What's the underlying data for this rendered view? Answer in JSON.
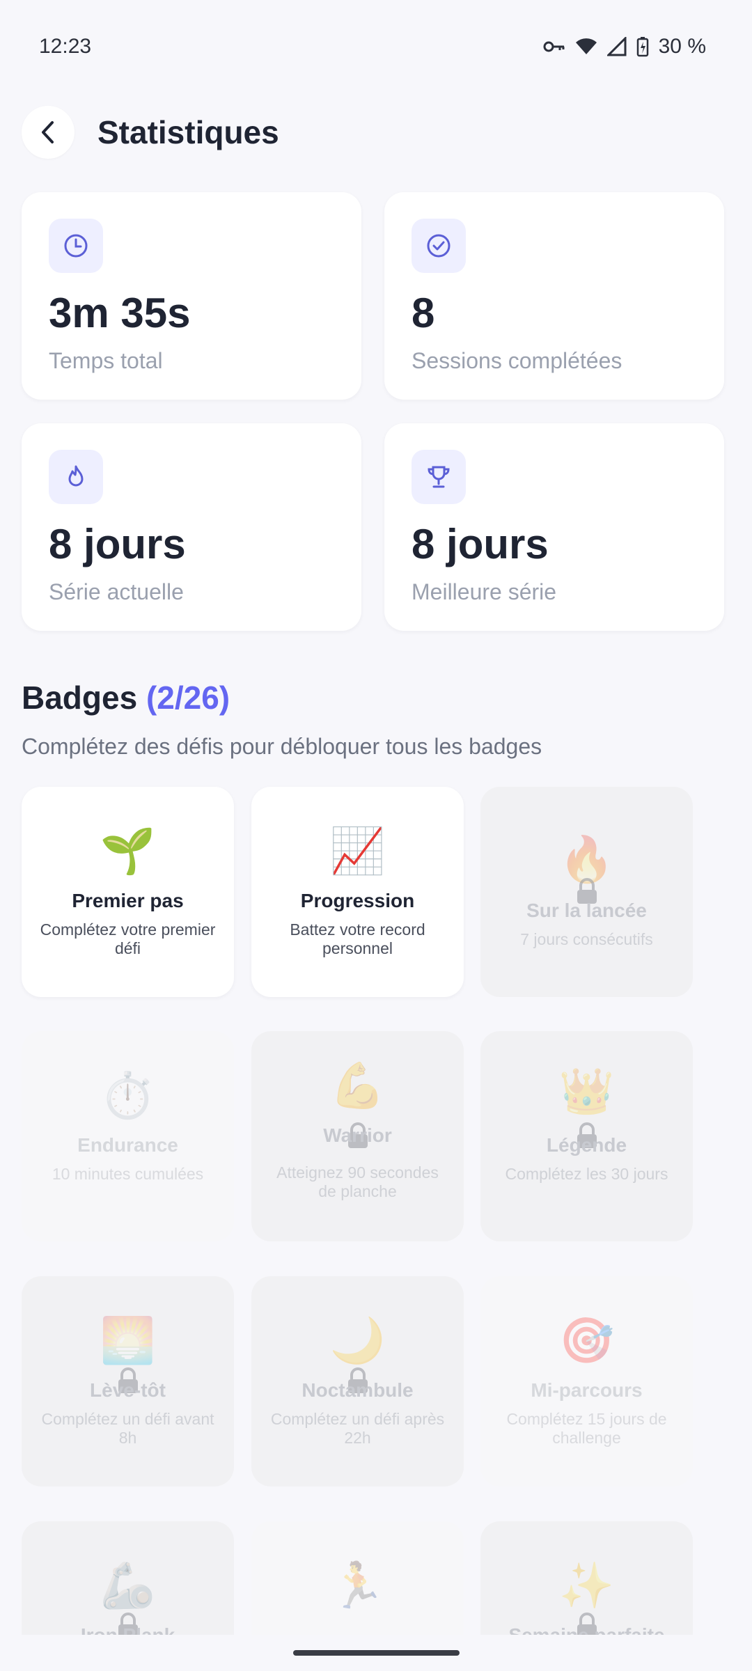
{
  "status_bar": {
    "time": "12:23",
    "battery": "30 %"
  },
  "header": {
    "title": "Statistiques"
  },
  "stats": [
    {
      "value": "3m 35s",
      "label": "Temps total",
      "icon": "clock-icon"
    },
    {
      "value": "8",
      "label": "Sessions complétées",
      "icon": "check-circle-icon"
    },
    {
      "value": "8 jours",
      "label": "Série actuelle",
      "icon": "flame-icon"
    },
    {
      "value": "8 jours",
      "label": "Meilleure série",
      "icon": "trophy-icon"
    }
  ],
  "badges": {
    "title": "Badges",
    "count": "(2/26)",
    "subtitle": "Complétez des défis pour débloquer tous les badges",
    "items": [
      {
        "emoji": "🌱",
        "name": "Premier pas",
        "desc": "Complétez votre premier défi",
        "locked": false
      },
      {
        "emoji": "📈",
        "name": "Progression",
        "desc": "Battez votre record personnel",
        "locked": false
      },
      {
        "emoji": "🔥",
        "name": "Sur la lancée",
        "desc": "7 jours consécutifs",
        "locked": true
      },
      {
        "emoji": "⏱️",
        "name": "Endurance",
        "desc": "10 minutes cumulées",
        "locked": true
      },
      {
        "emoji": "💪",
        "name": "Warrior",
        "desc": "Atteignez 90 secondes de planche",
        "locked": true
      },
      {
        "emoji": "👑",
        "name": "Légende",
        "desc": "Complétez les 30 jours",
        "locked": true
      },
      {
        "emoji": "🌅",
        "name": "Lève-tôt",
        "desc": "Complétez un défi avant 8h",
        "locked": true
      },
      {
        "emoji": "🌙",
        "name": "Noctambule",
        "desc": "Complétez un défi après 22h",
        "locked": true
      },
      {
        "emoji": "🎯",
        "name": "Mi-parcours",
        "desc": "Complétez 15 jours de challenge",
        "locked": true
      },
      {
        "emoji": "🦾",
        "name": "Iron Plank",
        "desc": "",
        "locked": true
      },
      {
        "emoji": "🏃",
        "name": "",
        "desc": "",
        "locked": true
      },
      {
        "emoji": "✨",
        "name": "Semaine parfaite",
        "desc": "",
        "locked": true
      }
    ]
  },
  "colors": {
    "accent": "#6366f1",
    "background": "#f7f7fb",
    "card": "#ffffff"
  }
}
